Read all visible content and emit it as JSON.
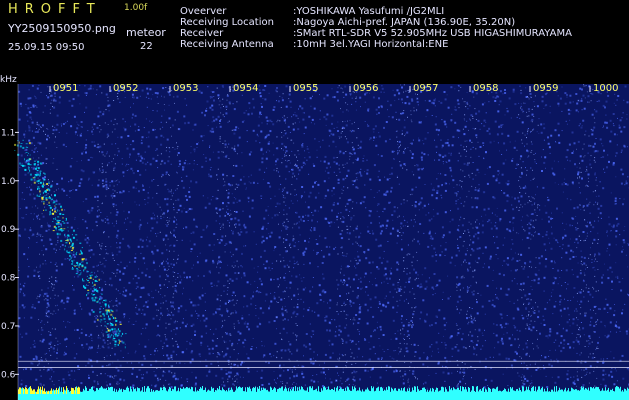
{
  "header": {
    "app_name": "HROFFT",
    "version": "1.00f",
    "filename": "YY2509150950.png",
    "datetime": "25.09.15 09:50",
    "meteor_label": "meteor",
    "meteor_count": "22",
    "info": [
      {
        "label": "Oveerver",
        "value": ":YOSHIKAWA Yasufumi /JG2MLI"
      },
      {
        "label": "Receiving Location",
        "value": ":Nagoya Aichi-pref. JAPAN (136.90E, 35.20N)"
      },
      {
        "label": "Receiver",
        "value": ":SMart RTL-SDR V5 52.905MHz USB HIGASHIMURAYAMA"
      },
      {
        "label": "Receiving Antenna",
        "value": ":10mH 3el.YAGI Horizontal:ENE"
      }
    ]
  },
  "chart_data": {
    "type": "heatmap",
    "ylabel": "kHz",
    "y_ticks": [
      "1.1",
      "1.0",
      "0.9",
      "0.8",
      "0.7",
      "0.6"
    ],
    "y_tick_values": [
      1.1,
      1.0,
      0.9,
      0.8,
      0.7,
      0.6
    ],
    "ylim": [
      0.58,
      1.2
    ],
    "minute_labels": [
      "0951",
      "0952",
      "0953",
      "0954",
      "0955",
      "0956",
      "0957",
      "0958",
      "0959",
      "1000"
    ],
    "colors": {
      "background": "#0a1560",
      "noise": "#4f6cff",
      "signal": "#00e0ff",
      "hot": "#ffff33",
      "baseline": "#30ffff"
    },
    "reference_lines_khz": [
      0.627,
      0.614
    ]
  }
}
